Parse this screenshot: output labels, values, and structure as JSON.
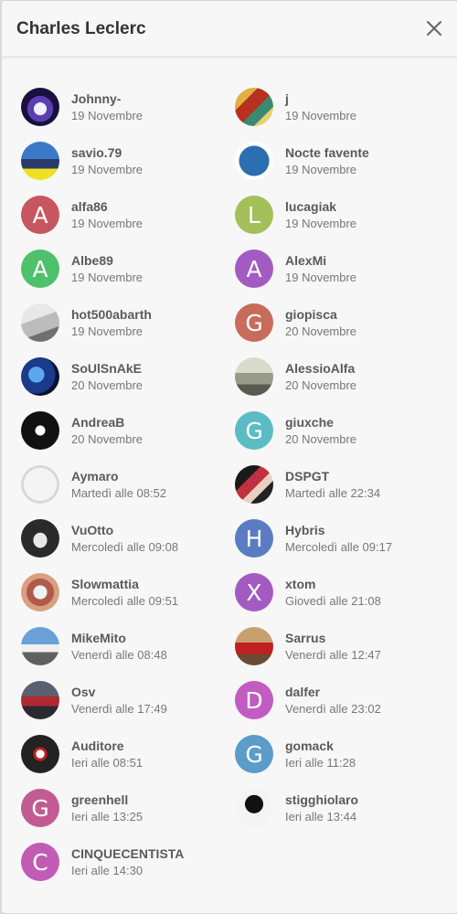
{
  "title": "Charles Leclerc",
  "users": [
    {
      "name": "Johnny-",
      "date": "19 Novembre",
      "avatar": "img",
      "bg": "radial-gradient(circle at 50% 55%, #f0f0ff 0 22%, #5b3fb0 23% 45%, #1a1040 46%)"
    },
    {
      "name": "j",
      "date": "19 Novembre",
      "avatar": "img",
      "bg": "linear-gradient(135deg,#e0b040 0 30%,#b83020 30% 55%,#3a8a70 55% 75%,#e8d070 75%)"
    },
    {
      "name": "savio.79",
      "date": "19 Novembre",
      "avatar": "img",
      "bg": "linear-gradient(180deg,#3a78c8 0 45%,#2a3a6a 45% 70%,#f0e020 70%)"
    },
    {
      "name": "Nocte favente",
      "date": "19 Novembre",
      "avatar": "img",
      "bg": "radial-gradient(circle,#2a6fb0 0 55%,#ffffff 56% 70%,#f0f0f0 71%)"
    },
    {
      "name": "alfa86",
      "date": "19 Novembre",
      "avatar": "A",
      "bg": "#c8565f"
    },
    {
      "name": "lucagiak",
      "date": "19 Novembre",
      "avatar": "L",
      "bg": "#a3c05b"
    },
    {
      "name": "Albe89",
      "date": "19 Novembre",
      "avatar": "A",
      "bg": "#4fc06b"
    },
    {
      "name": "AlexMi",
      "date": "19 Novembre",
      "avatar": "A",
      "bg": "#a35bc2"
    },
    {
      "name": "hot500abarth",
      "date": "19 Novembre",
      "avatar": "img",
      "bg": "linear-gradient(160deg,#e8e8e8 0 40%,#bcbcbc 40% 70%,#707070 70%)"
    },
    {
      "name": "giopisca",
      "date": "20 Novembre",
      "avatar": "G",
      "bg": "#c76b5a"
    },
    {
      "name": "SoUlSnAkE",
      "date": "20 Novembre",
      "avatar": "img",
      "bg": "radial-gradient(circle at 40% 45%,#5aa8f0 0 25%,#1a3a8a 26% 60%,#0a1030 61%)"
    },
    {
      "name": "AlessioAlfa",
      "date": "20 Novembre",
      "avatar": "img",
      "bg": "linear-gradient(180deg,#d8dccc 0 40%,#9a9a8a 40% 70%,#5a5a50 70%)"
    },
    {
      "name": "AndreaB",
      "date": "20 Novembre",
      "avatar": "img",
      "bg": "radial-gradient(circle,#ffffff 0 18%,#111111 19%)"
    },
    {
      "name": "giuxche",
      "date": "20 Novembre",
      "avatar": "G",
      "bg": "#5bbcc4"
    },
    {
      "name": "Aymaro",
      "date": "Martedì alle 08:52",
      "avatar": "img",
      "bg": "radial-gradient(circle,#f4f4f4 0 60%,#d8d8d8 61%)"
    },
    {
      "name": "DSPGT",
      "date": "Martedì alle 22:34",
      "avatar": "img",
      "bg": "linear-gradient(135deg,#1a1a1a 0 35%,#c03040 35% 55%,#e8d0c0 55% 70%,#222 70%)"
    },
    {
      "name": "VuOtto",
      "date": "Mercoledì alle 09:08",
      "avatar": "img",
      "bg": "radial-gradient(ellipse at 50% 55%,#e8e8e8 0 25%,#2a2a2a 26%)"
    },
    {
      "name": "Hybris",
      "date": "Mercoledì alle 09:17",
      "avatar": "H",
      "bg": "#5b7cc2"
    },
    {
      "name": "Slowmattia",
      "date": "Mercoledì alle 09:51",
      "avatar": "img",
      "bg": "radial-gradient(circle,#f0f0f0 0 25%,#b05a4a 26% 50%,#d8a080 51%)"
    },
    {
      "name": "xtom",
      "date": "Giovedì alle 21:08",
      "avatar": "X",
      "bg": "#a35bc2"
    },
    {
      "name": "MikeMito",
      "date": "Venerdì alle 08:48",
      "avatar": "img",
      "bg": "linear-gradient(180deg,#6aa0d8 0 45%,#f0f0f0 45% 65%,#606060 65%)"
    },
    {
      "name": "Sarrus",
      "date": "Venerdì alle 12:47",
      "avatar": "img",
      "bg": "linear-gradient(180deg,#c8a070 0 40%,#c02020 40% 70%,#6a4a30 70%)"
    },
    {
      "name": "Osv",
      "date": "Venerdì alle 17:49",
      "avatar": "img",
      "bg": "linear-gradient(180deg,#5a6070 0 40%,#b02830 40% 65%,#2a2a30 65%)"
    },
    {
      "name": "dalfer",
      "date": "Venerdì alle 23:02",
      "avatar": "D",
      "bg": "#c25bc2"
    },
    {
      "name": "Auditore",
      "date": "Ieri alle 08:51",
      "avatar": "img",
      "bg": "radial-gradient(circle,#ffffff 0 15%,#c02020 16% 25%,#222222 26%)"
    },
    {
      "name": "gomack",
      "date": "Ieri alle 11:28",
      "avatar": "G",
      "bg": "#5b9cc8"
    },
    {
      "name": "greenhell",
      "date": "Ieri alle 13:25",
      "avatar": "G",
      "bg": "#c25b92"
    },
    {
      "name": "stigghiolaro",
      "date": "Ieri alle 13:44",
      "avatar": "img",
      "bg": "radial-gradient(circle at 50% 40%,#111 0 30%,#f4f4f4 31%)"
    },
    {
      "name": "CINQUECENTISTA",
      "date": "Ieri alle 14:30",
      "avatar": "C",
      "bg": "#c25bb4"
    }
  ]
}
